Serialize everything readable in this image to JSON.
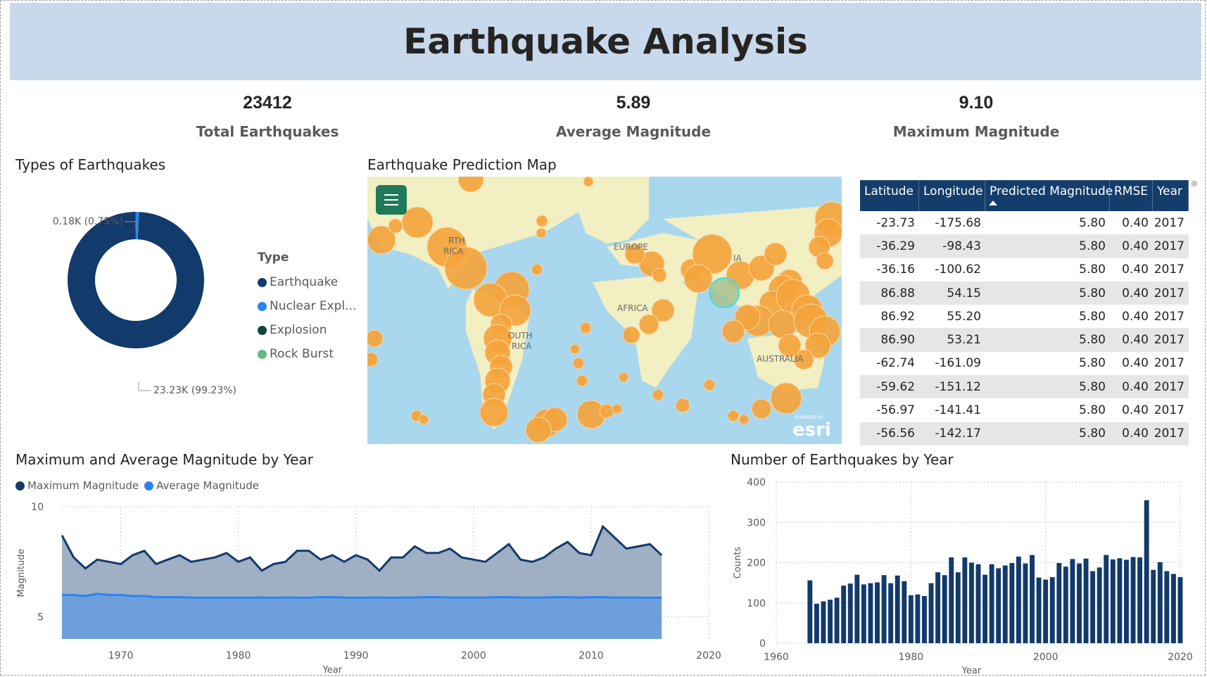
{
  "title": "Earthquake Analysis",
  "kpis": [
    {
      "value": "23412",
      "label": "Total Earthquakes"
    },
    {
      "value": "5.89",
      "label": "Average Magnitude"
    },
    {
      "value": "9.10",
      "label": "Maximum Magnitude"
    }
  ],
  "donut": {
    "title": "Types of Earthquakes",
    "legend_title": "Type",
    "label_small": "0.18K (0.75%)",
    "label_large": "23.23K (99.23%)",
    "legend": [
      {
        "label": "Earthquake",
        "color": "#123a6b"
      },
      {
        "label": "Nuclear Expl...",
        "color": "#2b84f0"
      },
      {
        "label": "Explosion",
        "color": "#0f4739"
      },
      {
        "label": "Rock Burst",
        "color": "#5fba7d"
      }
    ]
  },
  "map": {
    "title": "Earthquake Prediction Map",
    "labels": [
      "EUROPE",
      "AFRICA",
      "AUSTRALIA",
      "RTH",
      "RICA",
      "OUTH",
      "RICA",
      "IA"
    ],
    "attribution": "esri",
    "attribution_small": "POWERED BY"
  },
  "table": {
    "columns": [
      "Latitude",
      "Longitude",
      "Predicted Magnitude",
      "RMSE",
      "Year"
    ],
    "rows": [
      [
        "-23.73",
        "-175.68",
        "5.80",
        "0.40",
        "2017"
      ],
      [
        "-36.29",
        "-98.43",
        "5.80",
        "0.40",
        "2017"
      ],
      [
        "-36.16",
        "-100.62",
        "5.80",
        "0.40",
        "2017"
      ],
      [
        "86.88",
        "54.15",
        "5.80",
        "0.40",
        "2017"
      ],
      [
        "86.92",
        "55.20",
        "5.80",
        "0.40",
        "2017"
      ],
      [
        "86.90",
        "53.21",
        "5.80",
        "0.40",
        "2017"
      ],
      [
        "-62.74",
        "-161.09",
        "5.80",
        "0.40",
        "2017"
      ],
      [
        "-59.62",
        "-151.12",
        "5.80",
        "0.40",
        "2017"
      ],
      [
        "-56.97",
        "-141.41",
        "5.80",
        "0.40",
        "2017"
      ],
      [
        "-56.56",
        "-142.17",
        "5.80",
        "0.40",
        "2017"
      ]
    ]
  },
  "line_chart": {
    "title": "Maximum and Average Magnitude by Year",
    "legend": [
      {
        "label": "Maximum Magnitude",
        "color": "#123a6b"
      },
      {
        "label": "Average Magnitude",
        "color": "#2b84f0"
      }
    ]
  },
  "bar_chart": {
    "title": "Number of Earthquakes by Year"
  },
  "chart_data": [
    {
      "type": "pie",
      "title": "Types of Earthquakes",
      "categories": [
        "Earthquake",
        "Nuclear Explosion",
        "Explosion",
        "Rock Burst"
      ],
      "values": [
        23232,
        175,
        4,
        1
      ],
      "data_labels": [
        "23.23K (99.23%)",
        "0.18K (0.75%)"
      ]
    },
    {
      "type": "area",
      "title": "Maximum and Average Magnitude by Year",
      "xlabel": "Year",
      "ylabel": "Magnitude",
      "xlim": [
        1965,
        2020
      ],
      "ylim": [
        4,
        10
      ],
      "x_ticks": [
        1970,
        1980,
        1990,
        2000,
        2010,
        2020
      ],
      "y_ticks": [
        5,
        10
      ],
      "x": [
        1965,
        1966,
        1967,
        1968,
        1969,
        1970,
        1971,
        1972,
        1973,
        1974,
        1975,
        1976,
        1977,
        1978,
        1979,
        1980,
        1981,
        1982,
        1983,
        1984,
        1985,
        1986,
        1987,
        1988,
        1989,
        1990,
        1991,
        1992,
        1993,
        1994,
        1995,
        1996,
        1997,
        1998,
        1999,
        2000,
        2001,
        2002,
        2003,
        2004,
        2005,
        2006,
        2007,
        2008,
        2009,
        2010,
        2011,
        2012,
        2013,
        2014,
        2015,
        2016
      ],
      "series": [
        {
          "name": "Maximum Magnitude",
          "values": [
            8.7,
            7.7,
            7.2,
            7.6,
            7.5,
            7.4,
            7.8,
            8.0,
            7.4,
            7.6,
            7.8,
            7.5,
            7.6,
            7.7,
            7.9,
            7.5,
            7.7,
            7.1,
            7.4,
            7.5,
            8.0,
            8.0,
            7.6,
            7.8,
            7.5,
            7.8,
            7.6,
            7.1,
            7.7,
            7.7,
            8.2,
            7.9,
            7.9,
            8.1,
            7.7,
            7.6,
            7.5,
            7.9,
            8.3,
            7.6,
            7.5,
            7.7,
            8.1,
            8.4,
            7.9,
            7.8,
            9.1,
            8.6,
            8.1,
            8.2,
            8.3,
            7.8
          ]
        },
        {
          "name": "Average Magnitude",
          "values": [
            6.0,
            6.0,
            5.95,
            6.05,
            6.0,
            6.0,
            5.95,
            5.95,
            5.9,
            5.9,
            5.9,
            5.88,
            5.87,
            5.88,
            5.87,
            5.88,
            5.87,
            5.88,
            5.87,
            5.88,
            5.88,
            5.87,
            5.9,
            5.9,
            5.88,
            5.87,
            5.88,
            5.88,
            5.87,
            5.88,
            5.88,
            5.9,
            5.9,
            5.88,
            5.88,
            5.88,
            5.88,
            5.9,
            5.9,
            5.88,
            5.88,
            5.88,
            5.9,
            5.9,
            5.88,
            5.9,
            5.9,
            5.88,
            5.88,
            5.88,
            5.87,
            5.88
          ]
        }
      ]
    },
    {
      "type": "bar",
      "title": "Number of Earthquakes by Year",
      "xlabel": "Year",
      "ylabel": "Counts",
      "xlim": [
        1960,
        2020
      ],
      "ylim": [
        0,
        400
      ],
      "x_ticks": [
        1960,
        1980,
        2000,
        2020
      ],
      "y_ticks": [
        0,
        100,
        200,
        300,
        400
      ],
      "x": [
        1965,
        1966,
        1967,
        1968,
        1969,
        1970,
        1971,
        1972,
        1973,
        1974,
        1975,
        1976,
        1977,
        1978,
        1979,
        1980,
        1981,
        1982,
        1983,
        1984,
        1985,
        1986,
        1987,
        1988,
        1989,
        1990,
        1991,
        1992,
        1993,
        1994,
        1995,
        1996,
        1997,
        1998,
        1999,
        2000,
        2001,
        2002,
        2003,
        2004,
        2005,
        2006,
        2007,
        2008,
        2009,
        2010,
        2011,
        2012,
        2013,
        2014,
        2015,
        2016
      ],
      "values": [
        156,
        98,
        104,
        108,
        113,
        143,
        148,
        170,
        146,
        149,
        151,
        169,
        149,
        168,
        154,
        119,
        121,
        117,
        149,
        176,
        169,
        213,
        176,
        213,
        200,
        196,
        170,
        196,
        186,
        193,
        199,
        215,
        198,
        219,
        163,
        158,
        164,
        199,
        190,
        209,
        198,
        210,
        179,
        188,
        219,
        208,
        211,
        207,
        214,
        213,
        355,
        182,
        201,
        179,
        172,
        164
      ]
    }
  ]
}
